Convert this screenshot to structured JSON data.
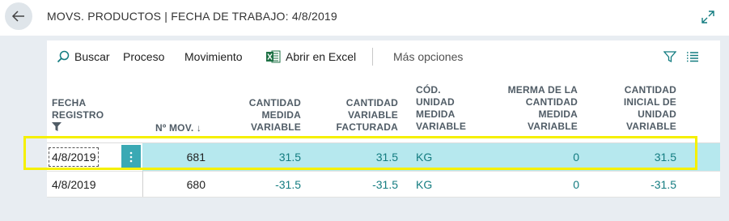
{
  "header": {
    "title": "MOVS. PRODUCTOS | FECHA DE TRABAJO: 4/8/2019"
  },
  "actions": {
    "search": "Buscar",
    "process": "Proceso",
    "movement": "Movimiento",
    "excel": "Abrir en Excel",
    "more": "Más opciones"
  },
  "columns": {
    "fecha_registro": [
      "FECHA",
      "REGISTRO"
    ],
    "n_mov": "Nº MOV. ↓",
    "cantidad_medida_variable": [
      "CANTIDAD",
      "MEDIDA",
      "VARIABLE"
    ],
    "cantidad_variable_facturada": [
      "CANTIDAD",
      "VARIABLE",
      "FACTURADA"
    ],
    "cod_unidad_medida_variable": [
      "CÓD.",
      "UNIDAD",
      "MEDIDA",
      "VARIABLE"
    ],
    "merma": [
      "MERMA DE LA",
      "CANTIDAD",
      "MEDIDA",
      "VARIABLE"
    ],
    "cantidad_inicial": [
      "CANTIDAD",
      "INICIAL DE",
      "UNIDAD",
      "VARIABLE"
    ]
  },
  "rows": [
    {
      "fecha": "4/8/2019",
      "n_mov": "681",
      "cant_medida": "31.5",
      "cant_facturada": "31.5",
      "cod_unidad": "KG",
      "merma": "0",
      "cant_inicial": "31.5"
    },
    {
      "fecha": "4/8/2019",
      "n_mov": "680",
      "cant_medida": "-31.5",
      "cant_facturada": "-31.5",
      "cod_unidad": "KG",
      "merma": "0",
      "cant_inicial": "-31.5"
    }
  ],
  "colors": {
    "accent": "#137c80",
    "selected_row": "#b6e8ee",
    "highlight": "#f5f000"
  }
}
